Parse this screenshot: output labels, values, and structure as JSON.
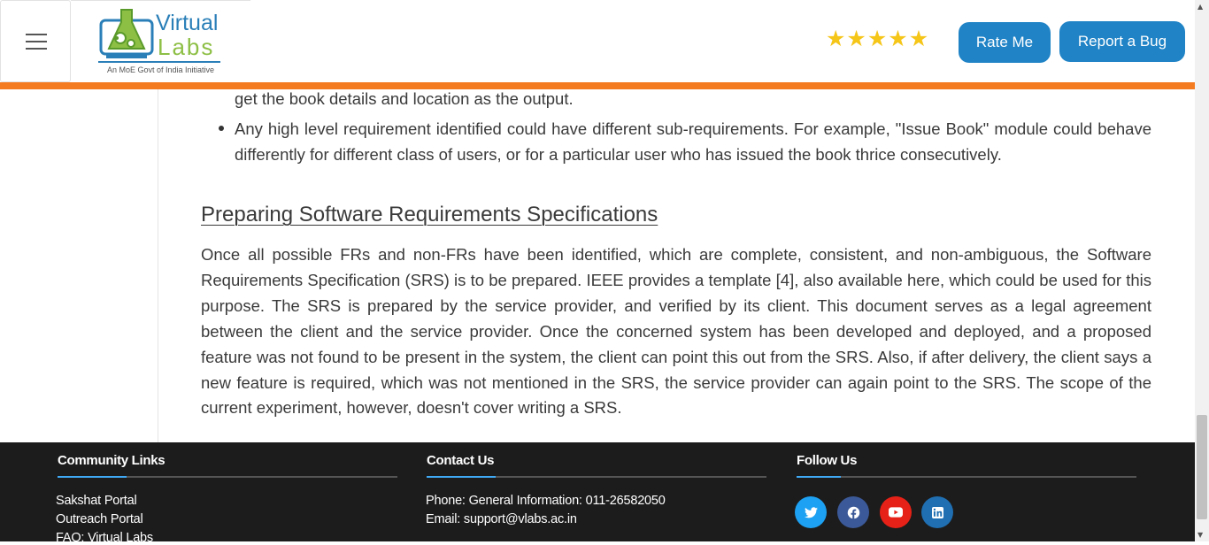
{
  "header": {
    "logo_line1": "Virtual",
    "logo_line2": "Labs",
    "logo_tagline": "An MoE Govt of India Initiative",
    "rating_stars": 5,
    "rate_button": "Rate Me",
    "bug_button": "Report a Bug"
  },
  "content": {
    "continued_line": "get the book details and location as the output.",
    "bullet_text": "Any high level requirement identified could have different sub-requirements. For example, \"Issue Book\" module could behave differently for different class of users, or for a particular user who has issued the book thrice consecutively.",
    "heading": "Preparing Software Requirements Specifications",
    "paragraph": "Once all possible FRs and non-FRs have been identified, which are complete, consistent, and non-ambiguous, the Software Requirements Specification (SRS) is to be prepared. IEEE provides a template [4], also available here, which could be used for this purpose. The SRS is prepared by the service provider, and verified by its client. This document serves as a legal agreement between the client and the service provider. Once the concerned system has been developed and deployed, and a proposed feature was not found to be present in the system, the client can point this out from the SRS. Also, if after delivery, the client says a new feature is required, which was not mentioned in the SRS, the service provider can again point to the SRS. The scope of the current experiment, however, doesn't cover writing a SRS."
  },
  "footer": {
    "community": {
      "title": "Community Links",
      "links": [
        "Sakshat Portal",
        "Outreach Portal",
        "FAQ: Virtual Labs"
      ]
    },
    "contact": {
      "title": "Contact Us",
      "phone": "Phone: General Information: 011-26582050",
      "email": "Email: support@vlabs.ac.in"
    },
    "follow": {
      "title": "Follow Us",
      "icons": [
        "twitter-icon",
        "facebook-icon",
        "youtube-icon",
        "linkedin-icon"
      ],
      "colors": [
        "#1da1f2",
        "#3b5998",
        "#e62117",
        "#1f6fb2"
      ]
    }
  },
  "colors": {
    "accent_orange": "#f47b20",
    "button_blue": "#1f83c6",
    "footer_bg": "#1c1c1c",
    "star_gold": "#f5c518"
  }
}
